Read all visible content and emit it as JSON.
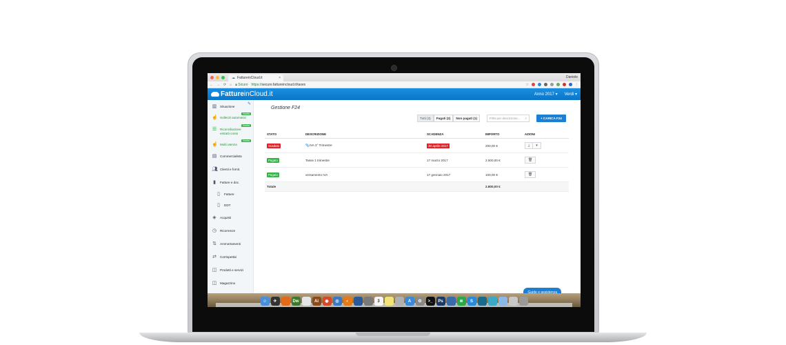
{
  "browser": {
    "tab_title": "FattureinCloud.it",
    "user": "Daniele",
    "secure_label": "Sicuro",
    "url_scheme": "https://",
    "url_rest": "secure.fattureincloud.it/taxes"
  },
  "header": {
    "logo_bold": "Fatture",
    "logo_rest": "inCloud.it",
    "year": "Anno 2017 ▾",
    "user": "Verdi ▾"
  },
  "sidebar": {
    "items": [
      {
        "label": "Situazione",
        "icon": "chart-icon"
      },
      {
        "label": "Solleciti automatici",
        "icon": "hand-icon",
        "badge": "Novità"
      },
      {
        "label": "Riconciliazione estratti conto",
        "icon": "list-icon",
        "badge": "Novità"
      },
      {
        "label": "Multi utenza",
        "icon": "hand-icon",
        "badge": "Novità"
      },
      {
        "label": "Commercialista",
        "icon": "briefcase-icon"
      },
      {
        "label": "Clienti e fornit.",
        "icon": "users-icon"
      },
      {
        "label": "Fatture e doc.",
        "icon": "document-icon"
      },
      {
        "label": "Fatture",
        "icon": "document-icon"
      },
      {
        "label": "DDT",
        "icon": "document-icon"
      },
      {
        "label": "Acquisti",
        "icon": "tag-icon"
      },
      {
        "label": "Ricorrenze",
        "icon": "clock-icon"
      },
      {
        "label": "Ammortamenti",
        "icon": "sort-icon"
      },
      {
        "label": "Corrispettivi",
        "icon": "arrows-icon"
      },
      {
        "label": "Prodotti e servizi",
        "icon": "box-icon"
      },
      {
        "label": "Magazzino",
        "icon": "box-icon"
      }
    ]
  },
  "main": {
    "title": "Gestione F24",
    "filters": [
      "Tutti (3)",
      "Pagati (2)",
      "Non pagati (1)"
    ],
    "search_placeholder": "Filtra per descrizione...",
    "upload_label": "+ CARICA F24",
    "columns": [
      "STATO",
      "DESCRIZIONE",
      "SCADENZA",
      "IMPORTO",
      "AZIONI"
    ],
    "rows": [
      {
        "status": "Scaduto",
        "status_color": "#e0232a",
        "description": "IVA 3° Trimestre",
        "due": "30 aprile 2017",
        "amount": "200,00 €"
      },
      {
        "status": "Pagato",
        "status_color": "#36b347",
        "description": "Tasse 1 trimestre",
        "due": "17 marzo 2017",
        "amount": "2.500,00 €"
      },
      {
        "status": "Pagato",
        "status_color": "#36b347",
        "description": "versamento IVA",
        "due": "17 gennaio 2017",
        "amount": "100,00 €"
      }
    ],
    "total_label": "Totale",
    "total_amount": "2.800,00 €"
  },
  "help_button": "Guide e assistenza",
  "colors": {
    "brand": "#0b75c8",
    "accent": "#1b7fd3",
    "danger": "#e0232a",
    "success": "#36b347"
  }
}
